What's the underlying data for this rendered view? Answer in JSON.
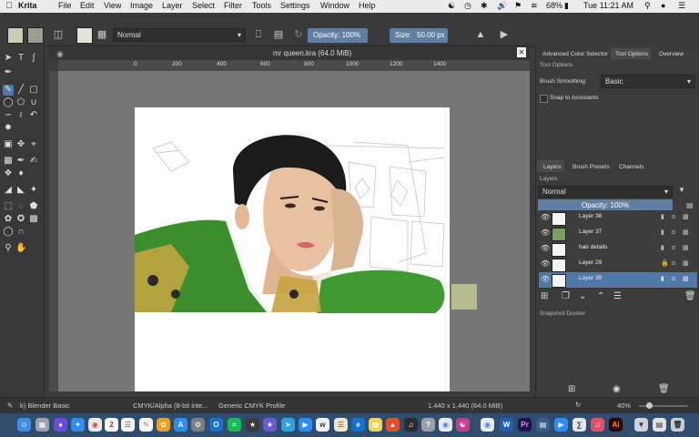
{
  "menubar": {
    "app": "Krita",
    "items": [
      "File",
      "Edit",
      "View",
      "Image",
      "Layer",
      "Select",
      "Filter",
      "Tools",
      "Settings",
      "Window",
      "Help"
    ],
    "battery": "68%",
    "clock": "Tue 11:21 AM"
  },
  "toolbar": {
    "blend_mode": "Normal",
    "opacity_label": "Opacity: 100%",
    "opacity_value": 1.0,
    "size_label": "Size:",
    "size_value": "50.00 px"
  },
  "document": {
    "title": "mr queen.kra (64.0 MiB)",
    "ruler_ticks": [
      "0",
      "200",
      "400",
      "600",
      "800",
      "1000",
      "1200",
      "1400"
    ]
  },
  "dock": {
    "top_tabs": [
      "Advanced Color Selector",
      "Tool Options",
      "Overview"
    ],
    "tool_options_header": "Tool Options",
    "brush_smoothing_label": "Brush Smoothing:",
    "brush_smoothing_value": "Basic",
    "snap_label": "Snap to Assistants",
    "mid_tabs": [
      "Layers",
      "Brush Presets",
      "Channels"
    ],
    "layers_header": "Layers",
    "layer_blend": "Normal",
    "layer_opacity": "Opacity: 100%",
    "layers": [
      {
        "name": "Layer 38",
        "selected": false
      },
      {
        "name": "Layer 37",
        "selected": false
      },
      {
        "name": "hair details",
        "selected": false
      },
      {
        "name": "Layer 29",
        "selected": false
      },
      {
        "name": "Layer 39",
        "selected": true
      }
    ],
    "snapshot_header": "Snapshot Docker"
  },
  "status": {
    "brush": "k) Blender Basic",
    "color_mode": "CMYK/Alpha (8-bit inte...",
    "profile": "Generic CMYK Profile",
    "dims": "1,440 x 1,440 (64.0 MiB)",
    "zoom": "40%"
  },
  "colors": {
    "accent": "#4f79a8",
    "dock_bg": "#2f4e6e"
  },
  "dock_apps": [
    "finder",
    "launchpad",
    "safari",
    "chrome",
    "calendar",
    "notes",
    "photos",
    "app-store",
    "system-preferences",
    "outlook",
    "spotify",
    "imovie",
    "telegram",
    "zoom",
    "wacom",
    "notes",
    "edge",
    "chrome",
    "brave",
    "itunes",
    "chrome",
    "adobe",
    "chrome",
    "word",
    "premiere",
    "trash"
  ]
}
